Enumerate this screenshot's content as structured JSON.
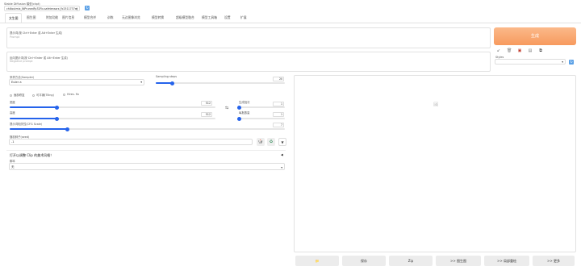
{
  "model": {
    "label": "Stable Diffusion 模型(ckpt)",
    "value": "chilloutmix_NiPrunedFp32Fix.safetensors [fc2511737a]"
  },
  "tabs": [
    "文生图",
    "图生图",
    "附加功能",
    "图片信息",
    "模型合并",
    "训练",
    "无边图像浏览",
    "模型转换",
    "超级模型融合",
    "模型工具箱",
    "设置",
    "扩展"
  ],
  "prompt": {
    "label": "提示词(按 Ctrl+Enter 或 Alt+Enter 生成)",
    "placeholder": "Prompt"
  },
  "negative": {
    "label": "反向提示词(按 Ctrl+Enter 或 Alt+Enter 生成)",
    "placeholder": "Negative prompt"
  },
  "generate_label": "生成",
  "styles_label": "Styles",
  "sampler": {
    "label": "采样方法(Sampler)",
    "value": "Euler a"
  },
  "steps": {
    "label": "Sampling steps",
    "value": "20",
    "fraction": 0.13
  },
  "checks": {
    "restore": "面部修复",
    "tiling": "可平铺(Tiling)",
    "hires": "Hires. fix"
  },
  "width": {
    "label": "宽度",
    "value": "512",
    "fraction": 0.23
  },
  "height": {
    "label": "高度",
    "value": "512",
    "fraction": 0.23
  },
  "batch_count": {
    "label": "生成批次",
    "value": "1",
    "fraction": 0.0
  },
  "batch_size": {
    "label": "每批数量",
    "value": "1",
    "fraction": 0.0
  },
  "cfg": {
    "label": "提示词相关性(CFG Scale)",
    "value": "7",
    "fraction": 0.21
  },
  "seed": {
    "label": "随机种子(seed)",
    "value": "-1"
  },
  "script_hint": "打开以调整 Clip 的美术风格！",
  "script": {
    "label": "脚本",
    "value": "无"
  },
  "bottom_buttons": [
    "保存",
    "Zip",
    ">> 图生图",
    ">> 局部重绘",
    ">> 更多"
  ],
  "colors": {
    "generate": "#f7a06a",
    "accent": "#2563eb"
  },
  "icons": {
    "swap": "⇆",
    "recycle": "♻",
    "dice": "🎲"
  }
}
